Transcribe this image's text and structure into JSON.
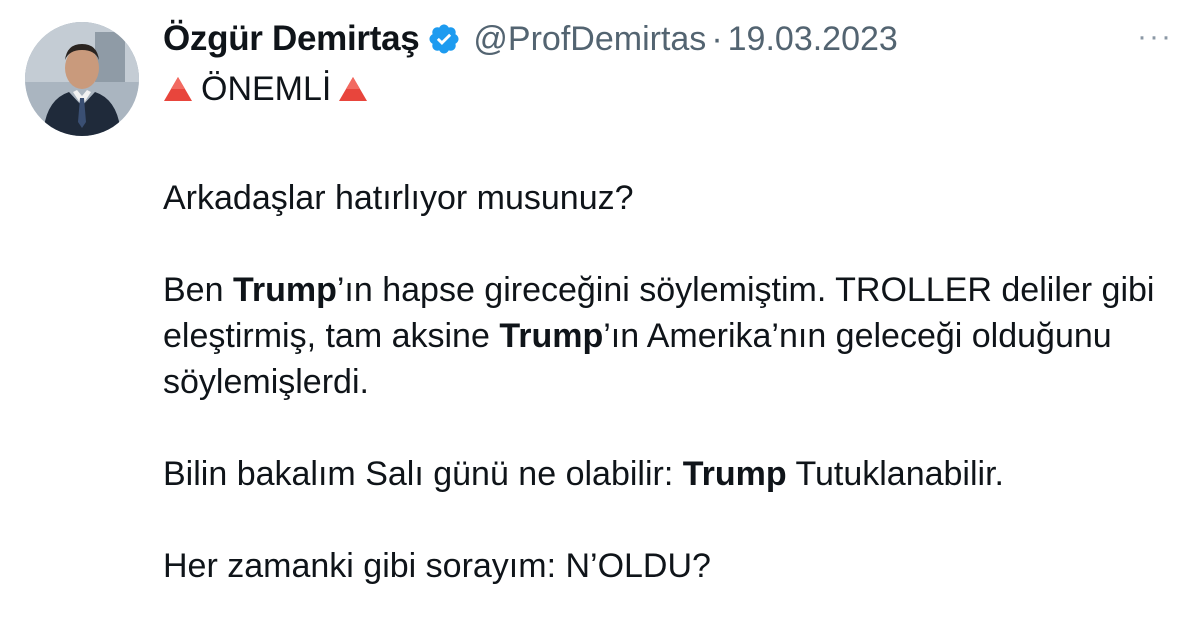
{
  "author": {
    "name": "Özgür Demirtaş",
    "handle": "@ProfDemirtas",
    "separator": "·",
    "date": "19.03.2023",
    "verified_icon": "verified-badge-icon",
    "verified_color": "#1d9bf0"
  },
  "more_icon": "more-dots-icon",
  "more_label": "···",
  "tweet": {
    "title": "ÖNEMLİ",
    "title_icon": "red-triangle-icon",
    "p1": "Arkadaşlar hatırlıyor musunuz?",
    "p2": {
      "t1": "Ben ",
      "b1": "Trump",
      "t2": "’ın hapse gireceğini söylemiştim. TROLLER deliler gibi eleştirmiş, tam aksine ",
      "b2": "Trump",
      "t3": "’ın Amerika’nın geleceği olduğunu söylemişlerdi."
    },
    "p3": {
      "t1": "Bilin bakalım Salı günü ne olabilir: ",
      "b1": "Trump",
      "t2": " Tutuklanabilir."
    },
    "p4": "Her zamanki gibi sorayım: N’OLDU?"
  },
  "colors": {
    "text": "#0f1419",
    "secondary": "#536471",
    "triangle": "#e8453c"
  }
}
